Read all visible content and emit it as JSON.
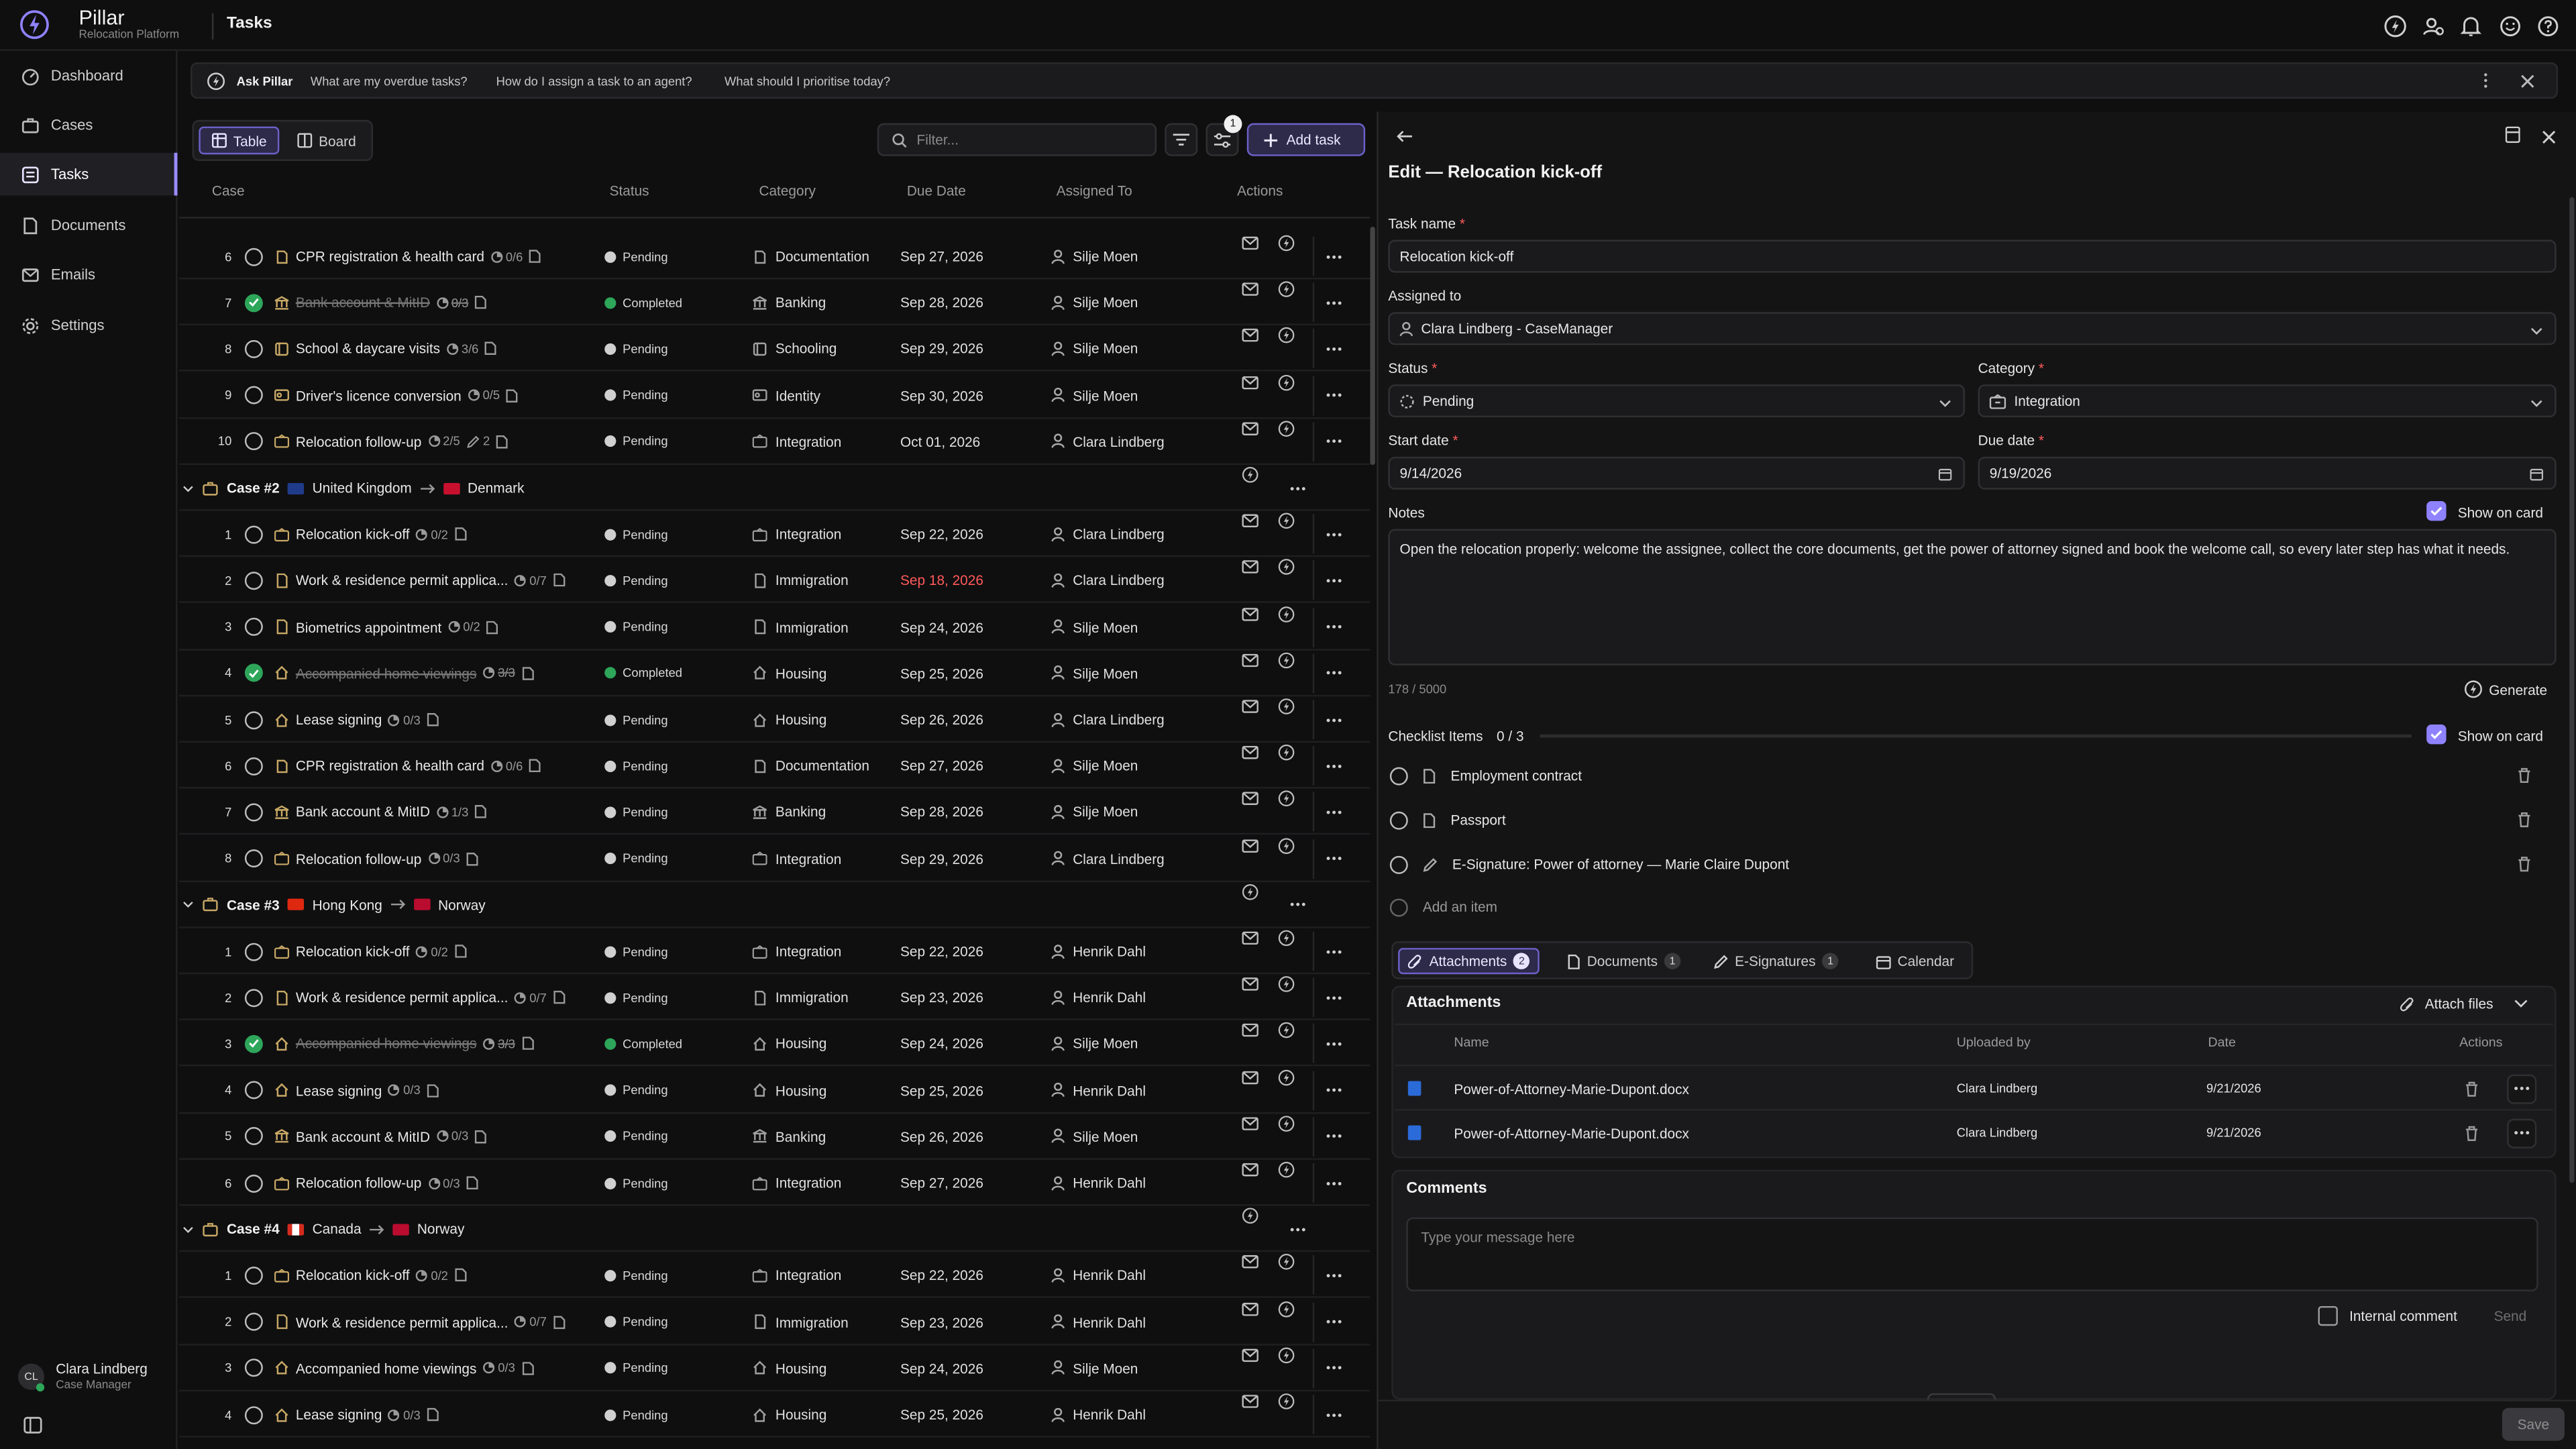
{
  "app": {
    "name": "Pillar",
    "subtitle": "Relocation Platform",
    "page_title": "Tasks"
  },
  "sidebar": {
    "items": [
      {
        "label": "Dashboard",
        "icon": "dashboard-icon"
      },
      {
        "label": "Cases",
        "icon": "briefcase-icon"
      },
      {
        "label": "Tasks",
        "icon": "tasks-icon",
        "active": true
      },
      {
        "label": "Documents",
        "icon": "document-icon"
      },
      {
        "label": "Emails",
        "icon": "mail-icon"
      },
      {
        "label": "Settings",
        "icon": "gear-icon"
      }
    ],
    "user": {
      "name": "Clara Lindberg",
      "role": "Case Manager",
      "initials": "CL"
    }
  },
  "ask": {
    "label": "Ask Pillar",
    "suggestions": [
      "What are my overdue tasks?",
      "How do I assign a task to an agent?",
      "What should I prioritise today?"
    ]
  },
  "toolbar": {
    "view_table": "Table",
    "view_board": "Board",
    "filter_placeholder": "Filter...",
    "filter_count": "1",
    "add_task": "Add task"
  },
  "table": {
    "headers": {
      "case": "Case",
      "status": "Status",
      "category": "Category",
      "due": "Due Date",
      "assigned": "Assigned To",
      "actions": "Actions"
    }
  },
  "groups": [
    {
      "case": null,
      "rows": [
        {
          "n": "6",
          "name": "CPR registration & health card",
          "sub": "0/6",
          "status": "Pending",
          "category": "Documentation",
          "due": "Sep 27, 2026",
          "assigned": "Silje Moen"
        },
        {
          "n": "7",
          "name": "Bank account & MitID",
          "sub": "0/3",
          "status": "Completed",
          "category": "Banking",
          "due": "Sep 28, 2026",
          "assigned": "Silje Moen",
          "done": true
        },
        {
          "n": "8",
          "name": "School & daycare visits",
          "sub": "3/6",
          "status": "Pending",
          "category": "Schooling",
          "due": "Sep 29, 2026",
          "assigned": "Silje Moen"
        },
        {
          "n": "9",
          "name": "Driver's licence conversion",
          "sub": "0/5",
          "status": "Pending",
          "category": "Identity",
          "due": "Sep 30, 2026",
          "assigned": "Silje Moen"
        },
        {
          "n": "10",
          "name": "Relocation follow-up",
          "sub": "2/5",
          "extra": "2",
          "status": "Pending",
          "category": "Integration",
          "due": "Oct 01, 2026",
          "assigned": "Clara Lindberg"
        }
      ]
    },
    {
      "case": {
        "id": "Case #2",
        "from": "United Kingdom",
        "to": "Denmark"
      },
      "rows": [
        {
          "n": "1",
          "name": "Relocation kick-off",
          "sub": "0/2",
          "status": "Pending",
          "category": "Integration",
          "due": "Sep 22, 2026",
          "assigned": "Clara Lindberg"
        },
        {
          "n": "2",
          "name": "Work & residence permit applica...",
          "sub": "0/7",
          "status": "Pending",
          "category": "Immigration",
          "due": "Sep 18, 2026",
          "assigned": "Clara Lindberg",
          "overdue": true
        },
        {
          "n": "3",
          "name": "Biometrics appointment",
          "sub": "0/2",
          "status": "Pending",
          "category": "Immigration",
          "due": "Sep 24, 2026",
          "assigned": "Silje Moen"
        },
        {
          "n": "4",
          "name": "Accompanied home viewings",
          "sub": "3/3",
          "status": "Completed",
          "category": "Housing",
          "due": "Sep 25, 2026",
          "assigned": "Silje Moen",
          "done": true
        },
        {
          "n": "5",
          "name": "Lease signing",
          "sub": "0/3",
          "status": "Pending",
          "category": "Housing",
          "due": "Sep 26, 2026",
          "assigned": "Clara Lindberg"
        },
        {
          "n": "6",
          "name": "CPR registration & health card",
          "sub": "0/6",
          "status": "Pending",
          "category": "Documentation",
          "due": "Sep 27, 2026",
          "assigned": "Silje Moen"
        },
        {
          "n": "7",
          "name": "Bank account & MitID",
          "sub": "1/3",
          "status": "Pending",
          "category": "Banking",
          "due": "Sep 28, 2026",
          "assigned": "Silje Moen"
        },
        {
          "n": "8",
          "name": "Relocation follow-up",
          "sub": "0/3",
          "status": "Pending",
          "category": "Integration",
          "due": "Sep 29, 2026",
          "assigned": "Clara Lindberg"
        }
      ]
    },
    {
      "case": {
        "id": "Case #3",
        "from": "Hong Kong",
        "to": "Norway"
      },
      "rows": [
        {
          "n": "1",
          "name": "Relocation kick-off",
          "sub": "0/2",
          "status": "Pending",
          "category": "Integration",
          "due": "Sep 22, 2026",
          "assigned": "Henrik Dahl"
        },
        {
          "n": "2",
          "name": "Work & residence permit applica...",
          "sub": "0/7",
          "status": "Pending",
          "category": "Immigration",
          "due": "Sep 23, 2026",
          "assigned": "Henrik Dahl"
        },
        {
          "n": "3",
          "name": "Accompanied home viewings",
          "sub": "3/3",
          "status": "Completed",
          "category": "Housing",
          "due": "Sep 24, 2026",
          "assigned": "Silje Moen",
          "done": true
        },
        {
          "n": "4",
          "name": "Lease signing",
          "sub": "0/3",
          "status": "Pending",
          "category": "Housing",
          "due": "Sep 25, 2026",
          "assigned": "Henrik Dahl"
        },
        {
          "n": "5",
          "name": "Bank account & MitID",
          "sub": "0/3",
          "status": "Pending",
          "category": "Banking",
          "due": "Sep 26, 2026",
          "assigned": "Silje Moen"
        },
        {
          "n": "6",
          "name": "Relocation follow-up",
          "sub": "0/3",
          "status": "Pending",
          "category": "Integration",
          "due": "Sep 27, 2026",
          "assigned": "Henrik Dahl"
        }
      ]
    },
    {
      "case": {
        "id": "Case #4",
        "from": "Canada",
        "to": "Norway"
      },
      "rows": [
        {
          "n": "1",
          "name": "Relocation kick-off",
          "sub": "0/2",
          "status": "Pending",
          "category": "Integration",
          "due": "Sep 22, 2026",
          "assigned": "Henrik Dahl"
        },
        {
          "n": "2",
          "name": "Work & residence permit applica...",
          "sub": "0/7",
          "status": "Pending",
          "category": "Immigration",
          "due": "Sep 23, 2026",
          "assigned": "Henrik Dahl"
        },
        {
          "n": "3",
          "name": "Accompanied home viewings",
          "sub": "0/3",
          "status": "Pending",
          "category": "Housing",
          "due": "Sep 24, 2026",
          "assigned": "Silje Moen"
        },
        {
          "n": "4",
          "name": "Lease signing",
          "sub": "0/3",
          "status": "Pending",
          "category": "Housing",
          "due": "Sep 25, 2026",
          "assigned": "Henrik Dahl"
        }
      ]
    }
  ],
  "panel": {
    "title": "Edit — Relocation kick-off",
    "task_name_label": "Task name",
    "task_name_value": "Relocation kick-off",
    "assigned_label": "Assigned to",
    "assigned_value": "Clara Lindberg - CaseManager",
    "status_label": "Status",
    "status_value": "Pending",
    "category_label": "Category",
    "category_value": "Integration",
    "start_label": "Start date",
    "start_value": "9/14/2026",
    "due_label": "Due date",
    "due_value": "9/19/2026",
    "notes_label": "Notes",
    "show_on_card": "Show on card",
    "notes_value": "Open the relocation properly: welcome the assignee, collect the core documents, get the power of attorney signed and book the welcome call, so every later step has what it needs.",
    "char_count": "178 / 5000",
    "generate": "Generate",
    "checklist_label": "Checklist Items",
    "checklist_count": "0 / 3",
    "checklist": [
      "Employment contract",
      "Passport",
      "E-Signature: Power of attorney — Marie Claire Dupont"
    ],
    "add_item": "Add an item",
    "tabs": [
      {
        "label": "Attachments",
        "count": "2"
      },
      {
        "label": "Documents",
        "count": "1"
      },
      {
        "label": "E-Signatures",
        "count": "1"
      },
      {
        "label": "Calendar",
        "count": ""
      }
    ],
    "attachments": {
      "title": "Attachments",
      "attach_files": "Attach files",
      "headers": {
        "name": "Name",
        "uploaded_by": "Uploaded by",
        "date": "Date",
        "actions": "Actions"
      },
      "rows": [
        {
          "name": "Power-of-Attorney-Marie-Dupont.docx",
          "uploaded_by": "Clara Lindberg",
          "date": "9/21/2026"
        },
        {
          "name": "Power-of-Attorney-Marie-Dupont.docx",
          "uploaded_by": "Clara Lindberg",
          "date": "9/21/2026"
        }
      ]
    },
    "comments": {
      "title": "Comments",
      "placeholder": "Type your message here",
      "internal": "Internal comment",
      "send": "Send"
    },
    "save": "Save"
  },
  "colors": {
    "accent": "#8f82ff",
    "completed": "#2ea65a",
    "overdue": "#ff5a5a",
    "background": "#0f0f10"
  }
}
